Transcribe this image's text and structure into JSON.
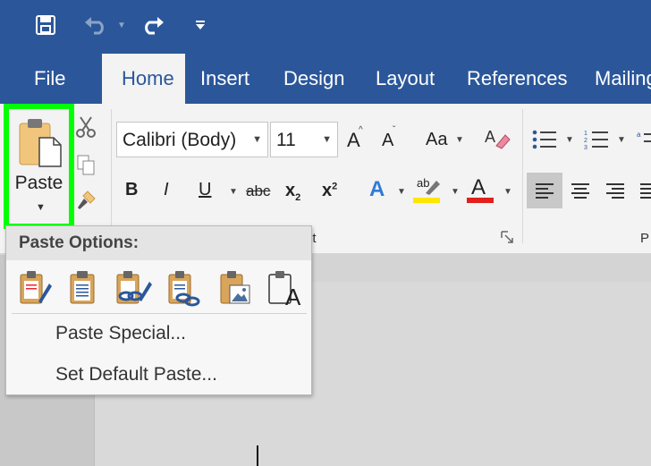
{
  "tabs": [
    {
      "label": "File",
      "active": false
    },
    {
      "label": "Home",
      "active": true
    },
    {
      "label": "Insert",
      "active": false
    },
    {
      "label": "Design",
      "active": false
    },
    {
      "label": "Layout",
      "active": false
    },
    {
      "label": "References",
      "active": false
    },
    {
      "label": "Mailing",
      "active": false
    }
  ],
  "clipboard": {
    "paste_label": "Paste"
  },
  "font": {
    "name": "Calibri (Body)",
    "size": "11",
    "case_label": "Aa",
    "bold": "B",
    "italic": "I",
    "underline": "U",
    "strikethrough": "abc",
    "subscript": "x",
    "subscript_mark": "2",
    "superscript": "x",
    "superscript_mark": "2",
    "grow": "A",
    "shrink": "A",
    "effects": "A",
    "font_color": "A",
    "highlight": "ab",
    "group_label_fragment": "nt",
    "paragraph_label_fragment": "P"
  },
  "paste_menu": {
    "title": "Paste Options:",
    "items": [
      "Paste Special...",
      "Set Default Paste..."
    ]
  },
  "colors": {
    "ribbon_blue": "#2b579a",
    "highlight_green": "#00ff00",
    "highlight_yellow": "#ffe600",
    "font_red": "#e0201b",
    "effects_blue": "#2f7bd6"
  }
}
